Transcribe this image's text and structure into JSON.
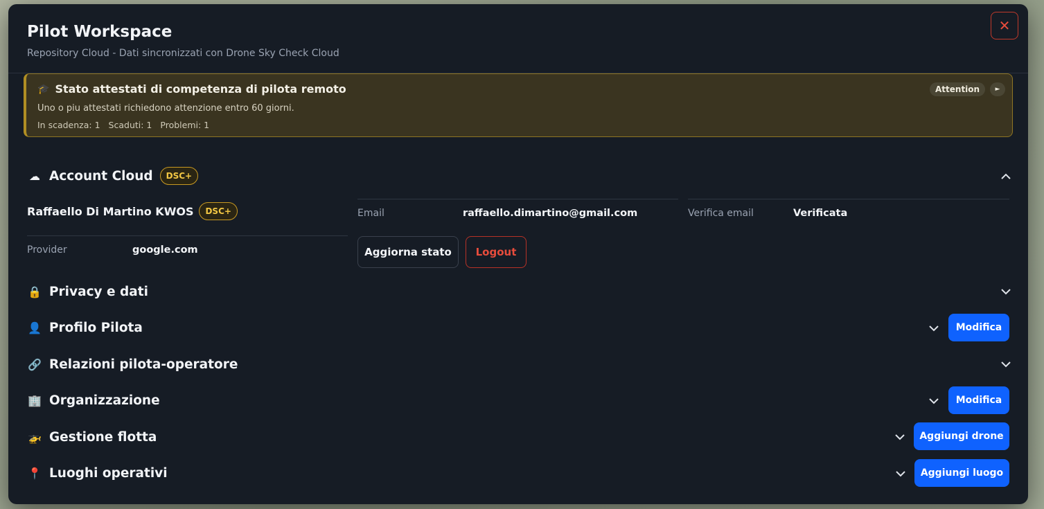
{
  "header": {
    "title": "Pilot Workspace",
    "subtitle": "Repository Cloud - Dati sincronizzati con Drone Sky Check Cloud",
    "close_label": "✕"
  },
  "alert": {
    "icon": "graduation-cap-icon",
    "title": "Stato attestati di competenza di pilota remoto",
    "message": "Uno o piu attestati richiedono attenzione entro 60 giorni.",
    "stats": [
      "In scadenza: 1",
      "Scaduti: 1",
      "Problemi: 1"
    ],
    "badge": "Attention",
    "play": "►"
  },
  "account": {
    "icon": "cloud-icon",
    "title": "Account Cloud",
    "badge": "DSC+",
    "name": "Raffaello Di Martino KWOS",
    "name_badge": "DSC+",
    "fields": {
      "email_label": "Email",
      "email_value": "raffaello.dimartino@gmail.com",
      "verify_label": "Verifica email",
      "verify_value": "Verificata",
      "provider_label": "Provider",
      "provider_value": "google.com"
    },
    "refresh_label": "Aggiorna stato",
    "logout_label": "Logout"
  },
  "sections": [
    {
      "icon": "lock-icon",
      "emoji": "🔒",
      "title": "Privacy e dati",
      "action": ""
    },
    {
      "icon": "user-icon",
      "emoji": "👤",
      "title": "Profilo Pilota",
      "action": "Modifica"
    },
    {
      "icon": "link-icon",
      "emoji": "🔗",
      "title": "Relazioni pilota-operatore",
      "action": ""
    },
    {
      "icon": "building-icon",
      "emoji": "🏢",
      "title": "Organizzazione",
      "action": "Modifica"
    },
    {
      "icon": "helicopter-icon",
      "emoji": "🚁",
      "title": "Gestione flotta",
      "action": "Aggiungi drone"
    },
    {
      "icon": "pin-icon",
      "emoji": "📍",
      "title": "Luoghi operativi",
      "action": "Aggiungi luogo"
    }
  ],
  "colors": {
    "accent": "#0f62fe",
    "danger": "#e74c3c",
    "warning_border": "#8e7524",
    "badge_gold": "#f2c744",
    "background": "#161c25"
  }
}
